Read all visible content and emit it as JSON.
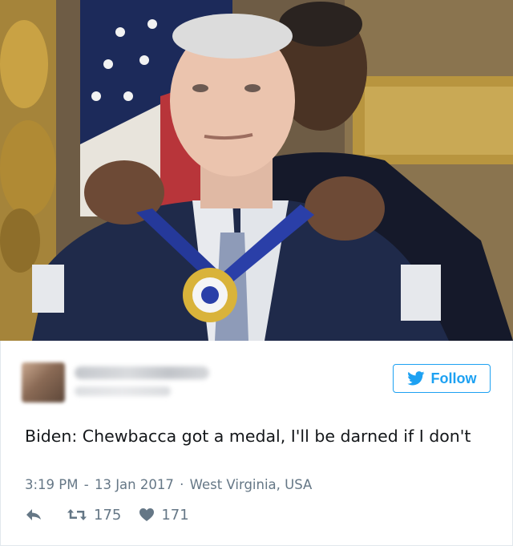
{
  "tweet": {
    "text": "Biden: Chewbacca got a medal, I'll be darned if I don't",
    "time": "3:19 PM",
    "date": "13 Jan 2017",
    "location": "West Virginia, USA",
    "retweets": "175",
    "likes": "171"
  },
  "follow_button": {
    "label": "Follow",
    "icon": "twitter-bird-icon",
    "color": "#1da1f2"
  },
  "icons": {
    "reply": "reply-arrow-icon",
    "retweet": "retweet-icon",
    "like": "heart-icon"
  },
  "colors": {
    "text": "#14171a",
    "meta": "#657786",
    "border": "#e1e8ed",
    "accent": "#1da1f2"
  }
}
